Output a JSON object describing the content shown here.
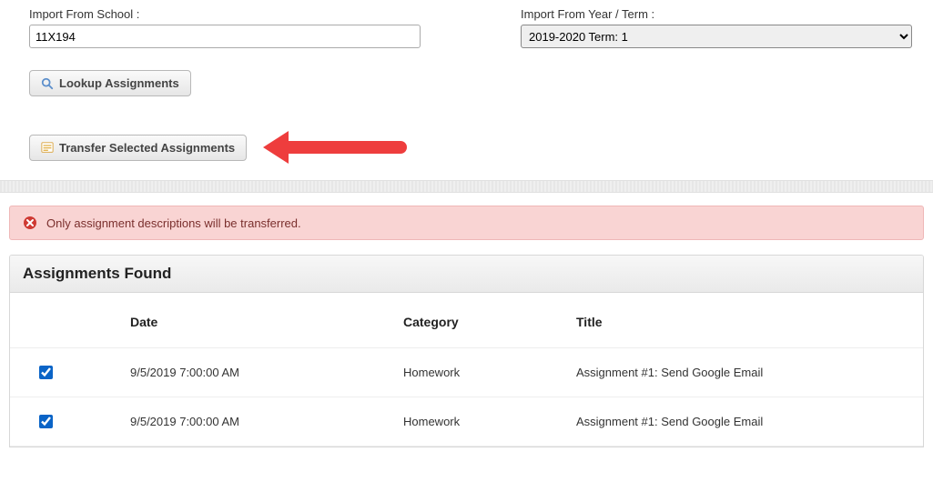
{
  "form": {
    "school_label": "Import From School :",
    "school_value": "11X194",
    "term_label": "Import From Year / Term :",
    "term_value": "2019-2020 Term: 1"
  },
  "buttons": {
    "lookup": "Lookup Assignments",
    "transfer": "Transfer Selected Assignments"
  },
  "alert": {
    "text": "Only assignment descriptions will be transferred."
  },
  "panel": {
    "title": "Assignments Found"
  },
  "table": {
    "headers": {
      "date": "Date",
      "category": "Category",
      "title": "Title"
    },
    "rows": [
      {
        "checked": true,
        "date": "9/5/2019 7:00:00 AM",
        "category": "Homework",
        "title": "Assignment #1: Send Google Email"
      },
      {
        "checked": true,
        "date": "9/5/2019 7:00:00 AM",
        "category": "Homework",
        "title": "Assignment #1: Send Google Email"
      }
    ]
  }
}
